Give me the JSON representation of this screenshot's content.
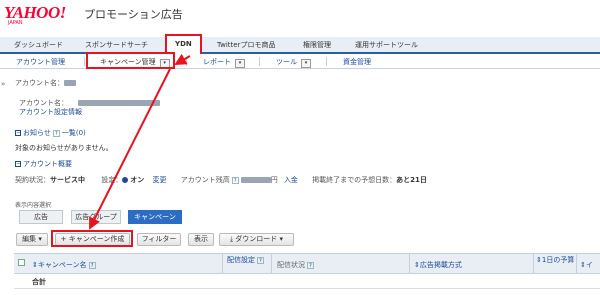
{
  "header": {
    "logo_text": "YAHOO!",
    "logo_sub": "JAPAN",
    "product_title": "プロモーション広告"
  },
  "nav": {
    "tabs": [
      {
        "label": "ダッシュボード"
      },
      {
        "label": "スポンサードサーチ"
      },
      {
        "label": "YDN"
      },
      {
        "label": "Twitterプロモ商品"
      },
      {
        "label": "権限管理"
      },
      {
        "label": "運用サポートツール"
      }
    ]
  },
  "subnav": {
    "items": [
      {
        "label": "アカウント管理"
      },
      {
        "label": "キャンペーン管理"
      },
      {
        "label": "レポート"
      },
      {
        "label": "ツール"
      },
      {
        "label": "資金管理"
      }
    ]
  },
  "account": {
    "name_label": "アカウント名：",
    "name_label2": "アカウント名：",
    "settings_link": "アカウント設定情報"
  },
  "notice": {
    "title": "お知らせ",
    "list_link": "一覧(0)",
    "message": "対象のお知らせがありません。"
  },
  "overview": {
    "title": "アカウント概要",
    "contract_label": "契約状況：",
    "contract_value": "サービス中",
    "setting_label": "設定：",
    "on_label": "オン",
    "change_link": "変更",
    "balance_label": "アカウント残高",
    "balance_suffix": "円",
    "deposit_link": "入金",
    "days_label": "掲載終了までの予想日数：",
    "days_value": "あと21日"
  },
  "view_select": {
    "label": "表示内容選択",
    "tabs": [
      {
        "label": "広告"
      },
      {
        "label": "広告グループ"
      },
      {
        "label": "キャンペーン"
      }
    ]
  },
  "toolbar": {
    "edit_label": "編集",
    "create_label": "キャンペーン作成",
    "filter_label": "フィルター",
    "display_label": "表示",
    "download_label": "ダウンロード"
  },
  "table": {
    "columns": [
      {
        "label": "キャンペーン名"
      },
      {
        "label": "配信設定"
      },
      {
        "label": "配信状況"
      },
      {
        "label": "広告掲載方式"
      },
      {
        "label": "1日の予算"
      },
      {
        "label": "イ"
      }
    ],
    "total_label": "合計"
  },
  "colors": {
    "highlight": "#e8131f",
    "brand": "#ff0033",
    "nav_blue": "#2b5da8",
    "active_tab": "#2b6cc4"
  }
}
